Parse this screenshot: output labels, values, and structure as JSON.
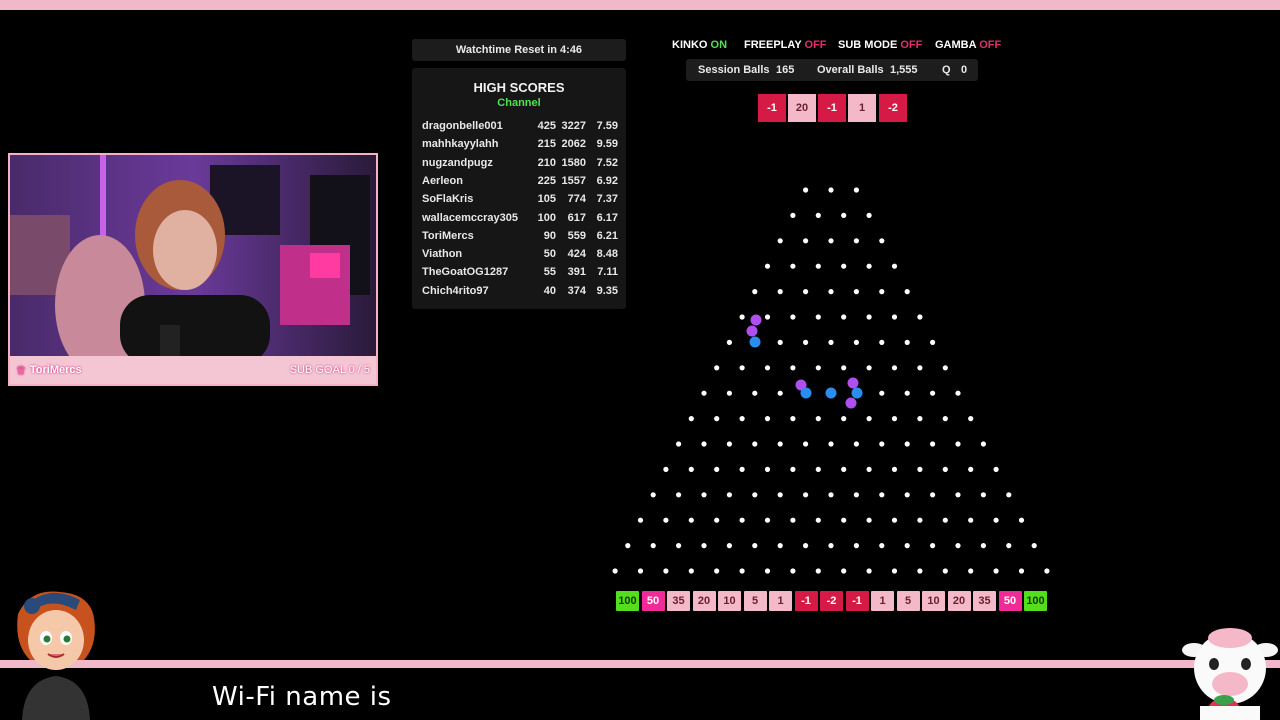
{
  "webcam": {
    "streamer_name": "ToriMercs",
    "sub_goal": "SUB GOAL  0 / 5"
  },
  "watchtime": {
    "text": "Watchtime Reset in 4:46"
  },
  "high_scores": {
    "title": "HIGH SCORES",
    "subtitle": "Channel",
    "rows": [
      {
        "name": "dragonbelle001",
        "a": "425",
        "b": "3227",
        "c": "7.59"
      },
      {
        "name": "mahhkayylahh",
        "a": "215",
        "b": "2062",
        "c": "9.59"
      },
      {
        "name": "nugzandpugz",
        "a": "210",
        "b": "1580",
        "c": "7.52"
      },
      {
        "name": "Aerleon",
        "a": "225",
        "b": "1557",
        "c": "6.92"
      },
      {
        "name": "SoFlaKris",
        "a": "105",
        "b": "774",
        "c": "7.37"
      },
      {
        "name": "wallacemccray305",
        "a": "100",
        "b": "617",
        "c": "6.17"
      },
      {
        "name": "ToriMercs",
        "a": "90",
        "b": "559",
        "c": "6.21"
      },
      {
        "name": "Viathon",
        "a": "50",
        "b": "424",
        "c": "8.48"
      },
      {
        "name": "TheGoatOG1287",
        "a": "55",
        "b": "391",
        "c": "7.11"
      },
      {
        "name": "Chich4rito97",
        "a": "40",
        "b": "374",
        "c": "9.35"
      }
    ]
  },
  "modes": {
    "kinko_label": "KINKO",
    "kinko_state": "ON",
    "freeplay_label": "FREEPLAY",
    "freeplay_state": "OFF",
    "sub_label": "SUB MODE",
    "sub_state": "OFF",
    "gamba_label": "GAMBA",
    "gamba_state": "OFF"
  },
  "stats": {
    "session_label": "Session Balls",
    "session_value": "165",
    "overall_label": "Overall Balls",
    "overall_value": "1,555",
    "q_label": "Q",
    "q_value": "0"
  },
  "top_buckets": [
    "-1",
    "20",
    "-1",
    "1",
    "-2"
  ],
  "bottom_buckets": [
    "100",
    "50",
    "35",
    "20",
    "10",
    "5",
    "1",
    "-1",
    "-2",
    "-1",
    "1",
    "5",
    "10",
    "20",
    "35",
    "50",
    "100"
  ],
  "ticker": {
    "text": "Wi-Fi name is"
  },
  "colors": {
    "accent_pink": "#f1b8c9",
    "bucket_red": "#d51b45",
    "bucket_green": "#54df1e",
    "bucket_magenta": "#f02a96",
    "status_on": "#55e055",
    "status_off": "#e0306e",
    "ball_purple": "#b04ef0",
    "ball_blue": "#2a8ef0"
  }
}
